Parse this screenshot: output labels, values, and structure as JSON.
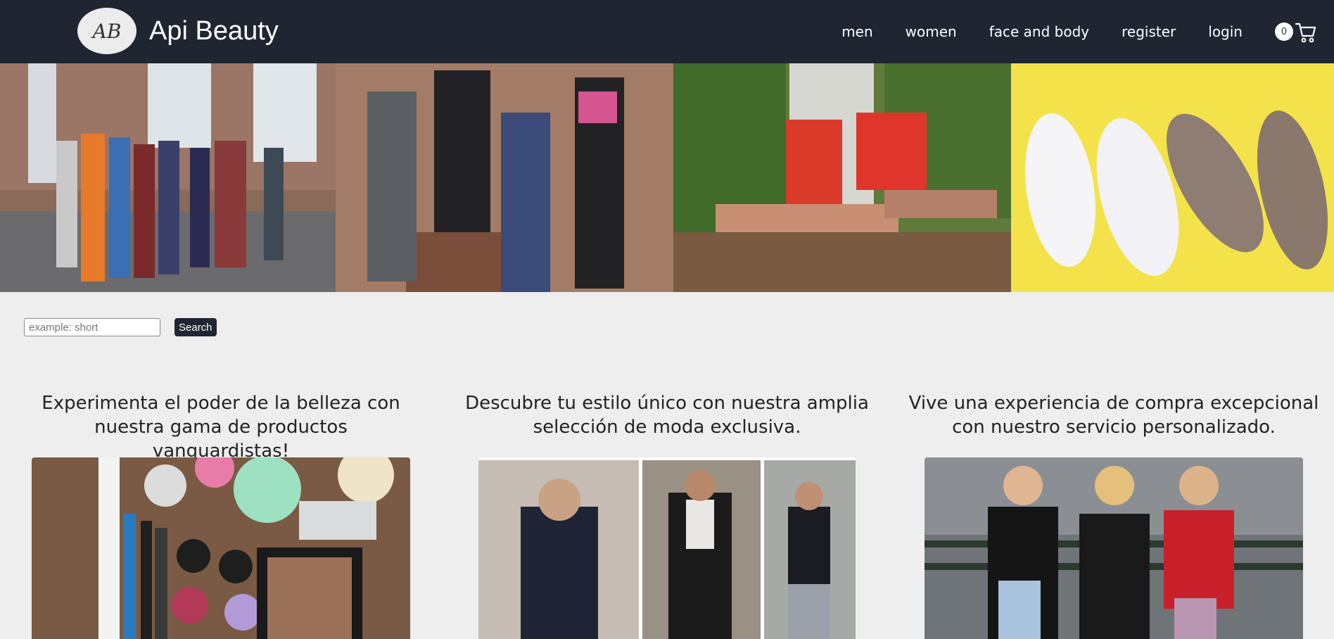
{
  "brand": {
    "logo_text": "AB",
    "name": "Api Beauty"
  },
  "nav": {
    "items": [
      "men",
      "women",
      "face and body",
      "register",
      "login"
    ]
  },
  "cart": {
    "count": "0"
  },
  "search": {
    "placeholder": "example: short",
    "value": "",
    "button_label": "Search"
  },
  "promos": [
    {
      "heading": "Experimenta el poder de la belleza con nuestra gama de productos vanguardistas!"
    },
    {
      "heading": "Descubre tu estilo único con nuestra amplia selección de moda exclusiva."
    },
    {
      "heading": "Vive una experiencia de compra excepcional con nuestro servicio personalizado."
    }
  ],
  "colors": {
    "navbar": "#1f2632",
    "page_bg": "#eeeeee",
    "hero_yellow": "#f4e24a"
  }
}
